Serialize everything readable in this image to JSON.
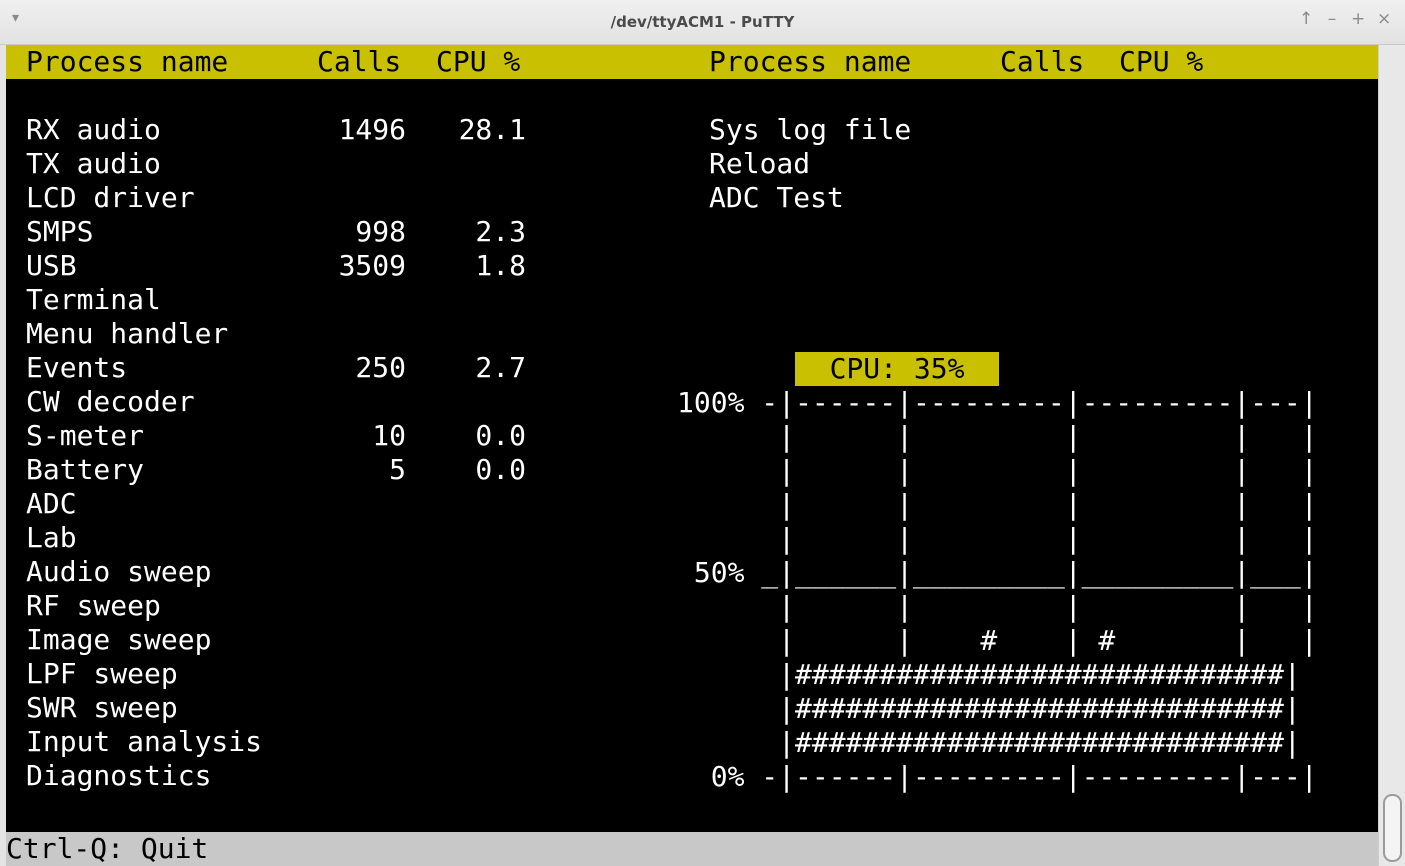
{
  "window": {
    "title": "/dev/ttyACM1 - PuTTY",
    "menu_glyph": "▾",
    "controls": [
      "↑",
      "–",
      "+",
      "×"
    ]
  },
  "header": {
    "left": {
      "process": "Process name",
      "calls": "Calls",
      "cpu": "CPU %"
    },
    "right": {
      "process": "Process name",
      "calls": "Calls",
      "cpu": "CPU %"
    }
  },
  "left_processes": [
    {
      "name": "RX audio",
      "calls": "1496",
      "cpu": "28.1"
    },
    {
      "name": "TX audio",
      "calls": "",
      "cpu": ""
    },
    {
      "name": "LCD driver",
      "calls": "",
      "cpu": ""
    },
    {
      "name": "SMPS",
      "calls": "998",
      "cpu": "2.3"
    },
    {
      "name": "USB",
      "calls": "3509",
      "cpu": "1.8"
    },
    {
      "name": "Terminal",
      "calls": "",
      "cpu": ""
    },
    {
      "name": "Menu handler",
      "calls": "",
      "cpu": ""
    },
    {
      "name": "Events",
      "calls": "250",
      "cpu": "2.7"
    },
    {
      "name": "CW decoder",
      "calls": "",
      "cpu": ""
    },
    {
      "name": "S-meter",
      "calls": "10",
      "cpu": "0.0"
    },
    {
      "name": "Battery",
      "calls": "5",
      "cpu": "0.0"
    },
    {
      "name": "ADC",
      "calls": "",
      "cpu": ""
    },
    {
      "name": "Lab",
      "calls": "",
      "cpu": ""
    },
    {
      "name": "Audio sweep",
      "calls": "",
      "cpu": ""
    },
    {
      "name": "RF sweep",
      "calls": "",
      "cpu": ""
    },
    {
      "name": "Image sweep",
      "calls": "",
      "cpu": ""
    },
    {
      "name": "LPF sweep",
      "calls": "",
      "cpu": ""
    },
    {
      "name": "SWR sweep",
      "calls": "",
      "cpu": ""
    },
    {
      "name": "Input analysis",
      "calls": "",
      "cpu": ""
    },
    {
      "name": "Diagnostics",
      "calls": "",
      "cpu": ""
    }
  ],
  "right_processes": [
    {
      "name": "Sys log file"
    },
    {
      "name": "Reload"
    },
    {
      "name": "ADC Test"
    }
  ],
  "cpu_graph": {
    "badge": "CPU: 35%",
    "lines": [
      "100% -|------|---------|---------|---|",
      "      |      |         |         |   |",
      "      |      |         |         |   |",
      "      |      |         |         |   |",
      "      |      |         |         |   |",
      " 50% _|______|_________|_________|___|",
      "      |      |         |         |   |",
      "      |      |    #    | #       |   |",
      "      |#############################|",
      "      |#############################|",
      "      |#############################|",
      "  0% -|------|---------|---------|---|"
    ]
  },
  "status": {
    "text": "Ctrl-Q: Quit"
  }
}
